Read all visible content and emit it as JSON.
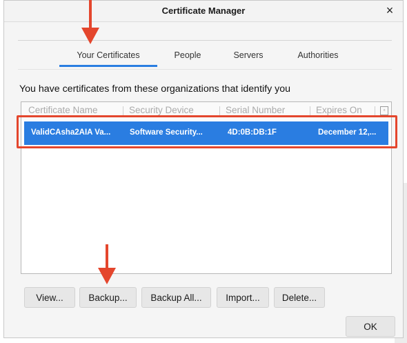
{
  "dialog": {
    "title": "Certificate Manager",
    "close_glyph": "×"
  },
  "tabs": [
    {
      "label": "Your Certificates",
      "active": true
    },
    {
      "label": "People",
      "active": false
    },
    {
      "label": "Servers",
      "active": false
    },
    {
      "label": "Authorities",
      "active": false
    }
  ],
  "intro_text": "You have certificates from these organizations that identify you",
  "table": {
    "columns": [
      "Certificate Name",
      "Security Device",
      "Serial Number",
      "Expires On"
    ],
    "rows": [
      {
        "name": "ValidCAsha2AIA Va...",
        "device": "Software Security...",
        "serial": "4D:0B:DB:1F",
        "expires": "December 12,..."
      }
    ]
  },
  "buttons": {
    "view": "View...",
    "backup": "Backup...",
    "backup_all": "Backup All...",
    "import": "Import...",
    "delete": "Delete...",
    "ok": "OK"
  },
  "colors": {
    "accent": "#2a7de1",
    "annotation": "#e4462d"
  }
}
